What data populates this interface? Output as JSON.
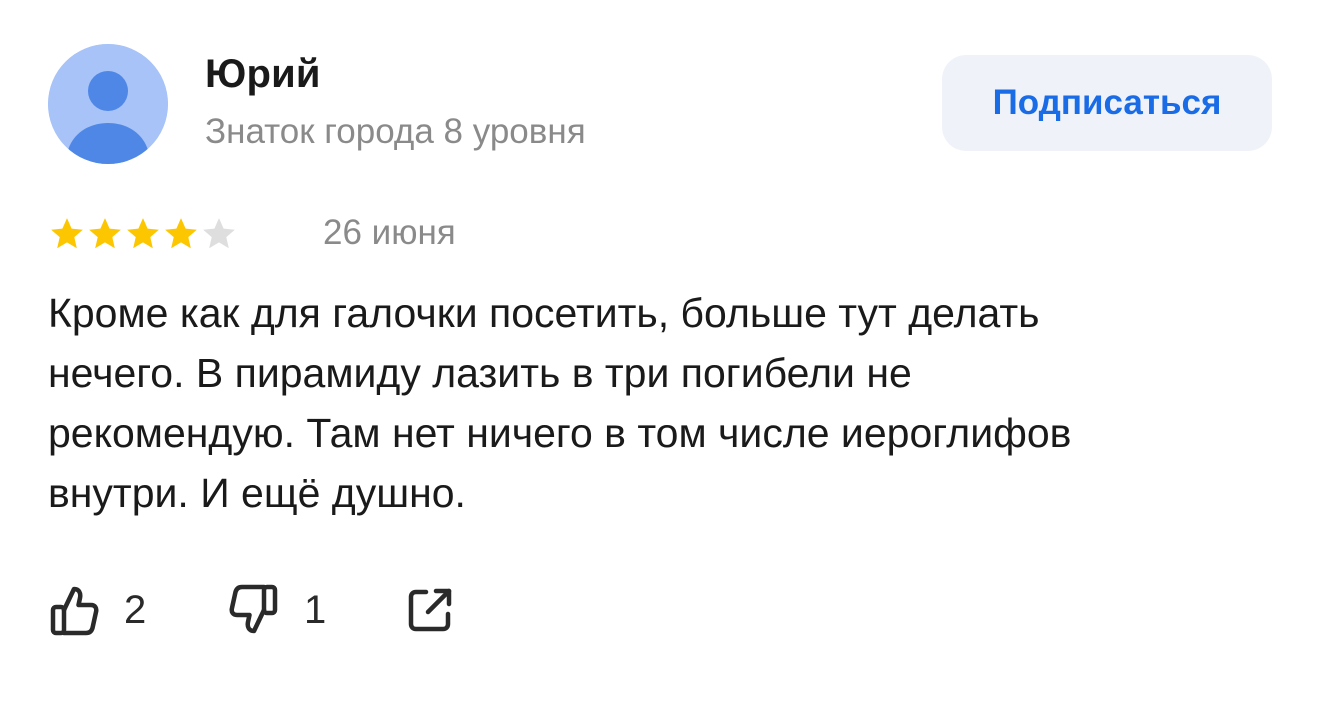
{
  "author": {
    "name": "Юрий",
    "level": "Знаток города 8 уровня",
    "avatar_icon": "user-avatar-icon"
  },
  "subscribe": {
    "label": "Подписаться"
  },
  "rating": {
    "value": 4,
    "max": 5,
    "filled_color": "#fcc600",
    "empty_color": "#dedede"
  },
  "date": "26 июня",
  "text_lines": [
    "Кроме как для галочки посетить, больше тут делать",
    "нечего. В пирамиду лазить в три погибели не",
    "рекомендую. Там нет ничего в том числе иероглифов",
    "внутри. И ещё душно."
  ],
  "actions": {
    "likes": {
      "count": "2",
      "icon": "thumbs-up-icon"
    },
    "dislikes": {
      "count": "1",
      "icon": "thumbs-down-icon"
    },
    "share": {
      "icon": "share-icon"
    }
  },
  "colors": {
    "accent": "#1a6be6",
    "button_bg": "#eff3f9",
    "muted_text": "#8a8a8a"
  }
}
